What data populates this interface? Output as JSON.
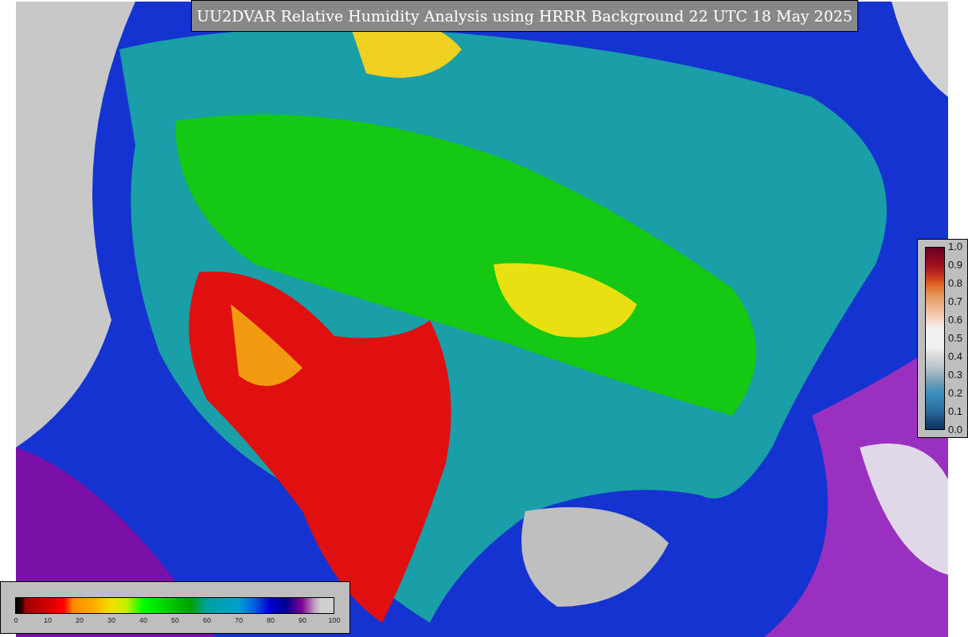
{
  "title": "UU2DVAR Relative Humidity Analysis using HRRR Background 22 UTC 18 May 2025",
  "humidity_colorbar": {
    "ticks": [
      "0",
      "10",
      "20",
      "30",
      "40",
      "50",
      "60",
      "70",
      "80",
      "90",
      "100"
    ]
  },
  "observation_colorbar": {
    "ticks": [
      "1.0",
      "0.9",
      "0.8",
      "0.7",
      "0.6",
      "0.5",
      "0.4",
      "0.3",
      "0.2",
      "0.1",
      "0.0"
    ]
  }
}
